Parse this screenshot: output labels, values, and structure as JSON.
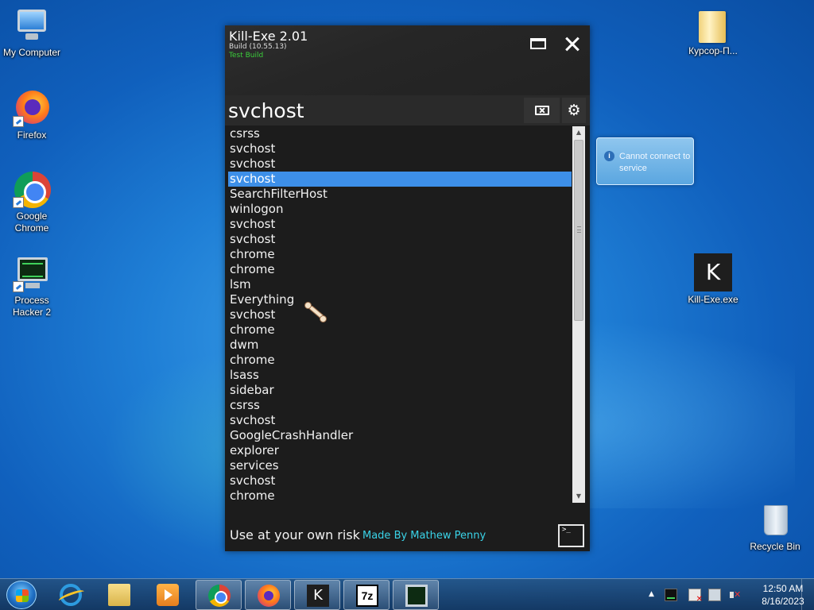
{
  "desktop": {
    "icons": [
      {
        "label": "My Computer"
      },
      {
        "label": "Firefox"
      },
      {
        "label": "Google Chrome"
      },
      {
        "label": "Process Hacker 2"
      },
      {
        "label": "Курсор-П..."
      },
      {
        "label": "Kill-Exe.exe"
      },
      {
        "label": "Recycle Bin"
      }
    ],
    "kill_exe_letter": "K"
  },
  "notification": {
    "icon": "info-icon",
    "text": "Cannot connect to service"
  },
  "app": {
    "title": "Kill-Exe 2.01",
    "build": "Build (10.55.13)",
    "build_type": "Test Build",
    "build_type_color": "#3bcf3b",
    "search_value": "svchost",
    "settings_glyph": "⚙",
    "processes": [
      "csrss",
      "svchost",
      "svchost",
      "svchost",
      "SearchFilterHost",
      "winlogon",
      "svchost",
      "svchost",
      "chrome",
      "chrome",
      "lsm",
      "Everything",
      "svchost",
      "chrome",
      "dwm",
      "chrome",
      "lsass",
      "sidebar",
      "csrss",
      "svchost",
      "GoogleCrashHandler",
      "explorer",
      "services",
      "svchost",
      "chrome"
    ],
    "selected_index": 3,
    "selection_color": "#3d8fe8",
    "footer_warning": "Use at your own risk",
    "footer_credit": "Made By Mathew Penny",
    "credit_color": "#3ad3e8",
    "console_prompt": ">_"
  },
  "taskbar": {
    "apps": [
      "start",
      "internet-explorer",
      "windows-explorer",
      "media-player",
      "chrome",
      "firefox",
      "kill-exe",
      "7-zip",
      "process-hacker"
    ],
    "k_letter": "K",
    "zip_label": "7z",
    "clock_time": "12:50 AM",
    "clock_date": "8/16/2023",
    "tray_arrow": "▲"
  }
}
